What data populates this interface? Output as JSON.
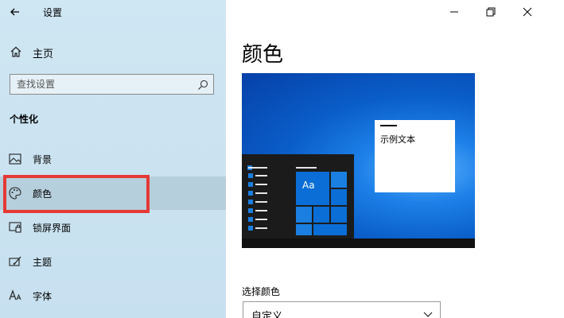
{
  "app": {
    "title": "设置"
  },
  "sidebar": {
    "home_label": "主页",
    "search_placeholder": "查找设置",
    "section_title": "个性化",
    "items": [
      {
        "label": "背景",
        "icon": "image-icon"
      },
      {
        "label": "颜色",
        "icon": "palette-icon",
        "selected": true
      },
      {
        "label": "锁屏界面",
        "icon": "lock-screen-icon"
      },
      {
        "label": "主题",
        "icon": "theme-brush-icon"
      },
      {
        "label": "字体",
        "icon": "font-icon"
      }
    ]
  },
  "main": {
    "page_title": "颜色",
    "preview": {
      "sample_text": "示例文本",
      "tile_label": "Aa"
    },
    "choose_color_label": "选择颜色",
    "choose_color_value": "自定义"
  },
  "colors": {
    "sidebar_bg": "#cfe6f3",
    "selected_bg": "#b6cfdc",
    "highlight_border": "#e53935",
    "accent": "#0b6ed6"
  }
}
